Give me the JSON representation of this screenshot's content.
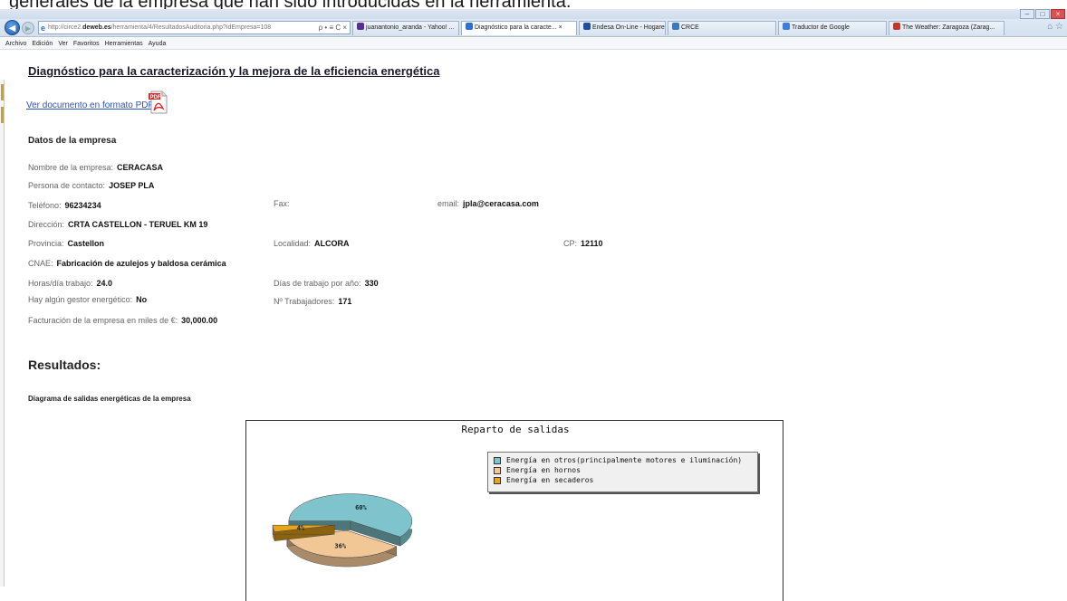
{
  "top_caption": "generales de la empresa que han sido introducidas en la herramienta.",
  "browser": {
    "url": "http://circe2.deweb.es/herramienta/4/ResultadosAuditoria.php?idEmpresa=108",
    "url_prefix": "http://circe2.",
    "url_domain": "deweb.es",
    "url_path": "/herramienta/4/ResultadosAuditoria.php?idEmpresa=108",
    "url_actions": "ρ • ≡ C ×",
    "tabs": [
      {
        "label": "juanantonio_aranda - Yahoo! ...",
        "color": "#5a2d91"
      },
      {
        "label": "Diagnóstico para la caracte...  ×",
        "color": "#2a6fd1"
      },
      {
        "label": "Endesa On-Line - Hogares",
        "color": "#1d4f9e"
      },
      {
        "label": "CRCE",
        "color": "#3a78c2"
      },
      {
        "label": "Traductor de Google",
        "color": "#3c7be0"
      },
      {
        "label": "The Weather: Zaragoza (Zarag...",
        "color": "#c0392b"
      }
    ],
    "menu": [
      "Archivo",
      "Edición",
      "Ver",
      "Favoritos",
      "Herramientas",
      "Ayuda"
    ]
  },
  "page": {
    "title": "Diagnóstico para la caracterización y la mejora de la eficiencia energética",
    "pdf_link": "Ver documento en formato PDF",
    "section_company": "Datos de la empresa",
    "fields": {
      "nombre": {
        "label": "Nombre de la empresa:",
        "value": "CERACASA"
      },
      "contacto": {
        "label": "Persona de contacto:",
        "value": "JOSEP PLA"
      },
      "telefono": {
        "label": "Teléfono:",
        "value": "96234234"
      },
      "fax": {
        "label": "Fax:",
        "value": ""
      },
      "email": {
        "label": "email:",
        "value": "jpla@ceracasa.com"
      },
      "direccion": {
        "label": "Dirección:",
        "value": "CRTA CASTELLON - TERUEL KM 19"
      },
      "provincia": {
        "label": "Provincia:",
        "value": "Castellon"
      },
      "localidad": {
        "label": "Localidad:",
        "value": "ALCORA"
      },
      "cp": {
        "label": "CP:",
        "value": "12110"
      },
      "cnae": {
        "label": "CNAE:",
        "value": "Fabricación de azulejos y baldosa cerámica"
      },
      "horas": {
        "label": "Horas/día trabajo:",
        "value": "24.0"
      },
      "dias": {
        "label": "Días de trabajo por año:",
        "value": "330"
      },
      "gestor": {
        "label": "Hay algún gestor energético:",
        "value": "No"
      },
      "trabajadores": {
        "label": "Nº Trabajadores:",
        "value": "171"
      },
      "facturacion": {
        "label": "Facturación de la empresa en miles de €:",
        "value": "30,000.00"
      }
    },
    "results_heading": "Resultados:",
    "diagram_heading": "Diagrama de salidas energéticas de la empresa"
  },
  "chart_data": {
    "type": "pie",
    "title": "Reparto de salidas",
    "legend_position": "top-right",
    "series": [
      {
        "name": "Energía en otros(principalmente motores e iluminación)",
        "value": 60,
        "label": "60%",
        "color": "#7fc4cc"
      },
      {
        "name": "Energía en hornos",
        "value": 36,
        "label": "36%",
        "color": "#f2c796"
      },
      {
        "name": "Energía en secaderos",
        "value": 4,
        "label": "4%",
        "color": "#e8a51b"
      }
    ]
  }
}
